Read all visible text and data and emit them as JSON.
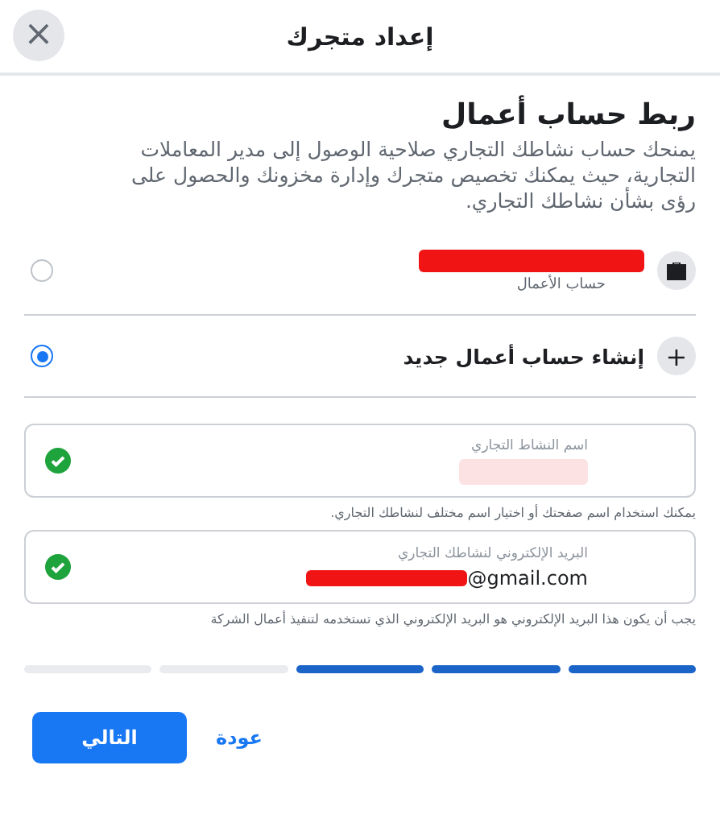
{
  "window": {
    "title": "إعداد متجرك",
    "close": "×"
  },
  "section": {
    "heading": "ربط حساب أعمال",
    "description": "يمنحك حساب نشاطك التجاري صلاحية الوصول إلى مدير المعاملات التجارية، حيث يمكنك تخصيص متجرك وإدارة مخزونك والحصول على رؤى بشأن نشاطك التجاري."
  },
  "options": [
    {
      "kind": "account",
      "subtitle": "حساب الأعمال",
      "redacted": true,
      "color": "#f01414",
      "selected": false
    },
    {
      "kind": "create",
      "label": "إنشاء حساب أعمال جديد",
      "icon": "+",
      "selected": true
    }
  ],
  "fields": [
    {
      "label": "اسم النشاط التجاري",
      "redacted": true,
      "color": "#fde2e4",
      "valid": true,
      "hint": "يمكنك استخدام اسم صفحتك أو اختيار اسم مختلف لنشاطك التجاري."
    },
    {
      "label": "البريد الإلكتروني لنشاطك التجاري",
      "value": "@gmail.com",
      "redacted": true,
      "color": "#f01414",
      "valid": true,
      "hint": "يجب أن يكون هذا البريد الإلكتروني هو البريد الإلكتروني الذي تستخدمه لتنفيذ أعمال الشركة"
    }
  ],
  "progress": [
    {
      "done": true
    },
    {
      "done": true
    },
    {
      "done": true
    },
    {
      "done": false
    },
    {
      "done": false
    }
  ],
  "buttons": {
    "back": "عودة",
    "next": "التالي"
  }
}
